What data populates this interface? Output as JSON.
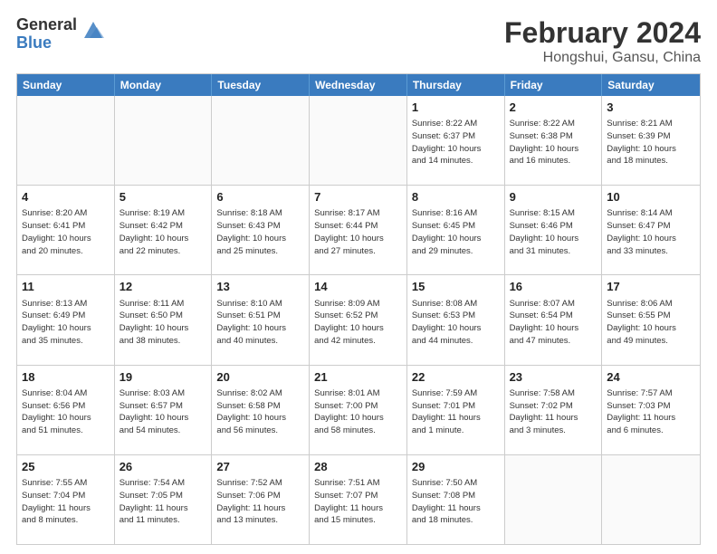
{
  "logo": {
    "general": "General",
    "blue": "Blue"
  },
  "title": "February 2024",
  "subtitle": "Hongshui, Gansu, China",
  "header_days": [
    "Sunday",
    "Monday",
    "Tuesday",
    "Wednesday",
    "Thursday",
    "Friday",
    "Saturday"
  ],
  "weeks": [
    [
      {
        "day": "",
        "info": ""
      },
      {
        "day": "",
        "info": ""
      },
      {
        "day": "",
        "info": ""
      },
      {
        "day": "",
        "info": ""
      },
      {
        "day": "1",
        "info": "Sunrise: 8:22 AM\nSunset: 6:37 PM\nDaylight: 10 hours\nand 14 minutes."
      },
      {
        "day": "2",
        "info": "Sunrise: 8:22 AM\nSunset: 6:38 PM\nDaylight: 10 hours\nand 16 minutes."
      },
      {
        "day": "3",
        "info": "Sunrise: 8:21 AM\nSunset: 6:39 PM\nDaylight: 10 hours\nand 18 minutes."
      }
    ],
    [
      {
        "day": "4",
        "info": "Sunrise: 8:20 AM\nSunset: 6:41 PM\nDaylight: 10 hours\nand 20 minutes."
      },
      {
        "day": "5",
        "info": "Sunrise: 8:19 AM\nSunset: 6:42 PM\nDaylight: 10 hours\nand 22 minutes."
      },
      {
        "day": "6",
        "info": "Sunrise: 8:18 AM\nSunset: 6:43 PM\nDaylight: 10 hours\nand 25 minutes."
      },
      {
        "day": "7",
        "info": "Sunrise: 8:17 AM\nSunset: 6:44 PM\nDaylight: 10 hours\nand 27 minutes."
      },
      {
        "day": "8",
        "info": "Sunrise: 8:16 AM\nSunset: 6:45 PM\nDaylight: 10 hours\nand 29 minutes."
      },
      {
        "day": "9",
        "info": "Sunrise: 8:15 AM\nSunset: 6:46 PM\nDaylight: 10 hours\nand 31 minutes."
      },
      {
        "day": "10",
        "info": "Sunrise: 8:14 AM\nSunset: 6:47 PM\nDaylight: 10 hours\nand 33 minutes."
      }
    ],
    [
      {
        "day": "11",
        "info": "Sunrise: 8:13 AM\nSunset: 6:49 PM\nDaylight: 10 hours\nand 35 minutes."
      },
      {
        "day": "12",
        "info": "Sunrise: 8:11 AM\nSunset: 6:50 PM\nDaylight: 10 hours\nand 38 minutes."
      },
      {
        "day": "13",
        "info": "Sunrise: 8:10 AM\nSunset: 6:51 PM\nDaylight: 10 hours\nand 40 minutes."
      },
      {
        "day": "14",
        "info": "Sunrise: 8:09 AM\nSunset: 6:52 PM\nDaylight: 10 hours\nand 42 minutes."
      },
      {
        "day": "15",
        "info": "Sunrise: 8:08 AM\nSunset: 6:53 PM\nDaylight: 10 hours\nand 44 minutes."
      },
      {
        "day": "16",
        "info": "Sunrise: 8:07 AM\nSunset: 6:54 PM\nDaylight: 10 hours\nand 47 minutes."
      },
      {
        "day": "17",
        "info": "Sunrise: 8:06 AM\nSunset: 6:55 PM\nDaylight: 10 hours\nand 49 minutes."
      }
    ],
    [
      {
        "day": "18",
        "info": "Sunrise: 8:04 AM\nSunset: 6:56 PM\nDaylight: 10 hours\nand 51 minutes."
      },
      {
        "day": "19",
        "info": "Sunrise: 8:03 AM\nSunset: 6:57 PM\nDaylight: 10 hours\nand 54 minutes."
      },
      {
        "day": "20",
        "info": "Sunrise: 8:02 AM\nSunset: 6:58 PM\nDaylight: 10 hours\nand 56 minutes."
      },
      {
        "day": "21",
        "info": "Sunrise: 8:01 AM\nSunset: 7:00 PM\nDaylight: 10 hours\nand 58 minutes."
      },
      {
        "day": "22",
        "info": "Sunrise: 7:59 AM\nSunset: 7:01 PM\nDaylight: 11 hours\nand 1 minute."
      },
      {
        "day": "23",
        "info": "Sunrise: 7:58 AM\nSunset: 7:02 PM\nDaylight: 11 hours\nand 3 minutes."
      },
      {
        "day": "24",
        "info": "Sunrise: 7:57 AM\nSunset: 7:03 PM\nDaylight: 11 hours\nand 6 minutes."
      }
    ],
    [
      {
        "day": "25",
        "info": "Sunrise: 7:55 AM\nSunset: 7:04 PM\nDaylight: 11 hours\nand 8 minutes."
      },
      {
        "day": "26",
        "info": "Sunrise: 7:54 AM\nSunset: 7:05 PM\nDaylight: 11 hours\nand 11 minutes."
      },
      {
        "day": "27",
        "info": "Sunrise: 7:52 AM\nSunset: 7:06 PM\nDaylight: 11 hours\nand 13 minutes."
      },
      {
        "day": "28",
        "info": "Sunrise: 7:51 AM\nSunset: 7:07 PM\nDaylight: 11 hours\nand 15 minutes."
      },
      {
        "day": "29",
        "info": "Sunrise: 7:50 AM\nSunset: 7:08 PM\nDaylight: 11 hours\nand 18 minutes."
      },
      {
        "day": "",
        "info": ""
      },
      {
        "day": "",
        "info": ""
      }
    ]
  ]
}
